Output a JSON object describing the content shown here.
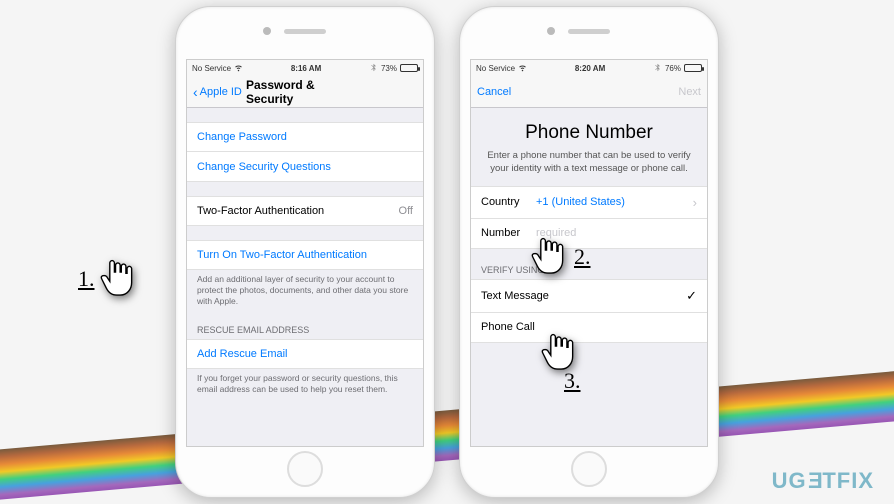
{
  "watermark": "UG≡TFIX",
  "callouts": {
    "c1": "1.",
    "c2": "2.",
    "c3": "3."
  },
  "phone1": {
    "status": {
      "carrier": "No Service",
      "time": "8:16 AM",
      "battery_pct": "73%"
    },
    "nav": {
      "back": "Apple ID",
      "title": "Password & Security"
    },
    "change_password": "Change Password",
    "change_security_q": "Change Security Questions",
    "tfa_label": "Two-Factor Authentication",
    "tfa_value": "Off",
    "turn_on_tfa": "Turn On Two-Factor Authentication",
    "tfa_footer": "Add an additional layer of security to your account to protect the photos, documents, and other data you store with Apple.",
    "rescue_header": "RESCUE EMAIL ADDRESS",
    "add_rescue": "Add Rescue Email",
    "rescue_footer": "If you forget your password or security questions, this email address can be used to help you reset them."
  },
  "phone2": {
    "status": {
      "carrier": "No Service",
      "time": "8:20 AM",
      "battery_pct": "76%"
    },
    "nav": {
      "cancel": "Cancel",
      "next": "Next"
    },
    "title": "Phone Number",
    "description": "Enter a phone number that can be used to verify your identity with a text message or phone call.",
    "country_label": "Country",
    "country_value": "+1 (United States)",
    "number_label": "Number",
    "number_placeholder": "required",
    "verify_header": "VERIFY USING:",
    "text_message": "Text Message",
    "phone_call": "Phone Call"
  }
}
